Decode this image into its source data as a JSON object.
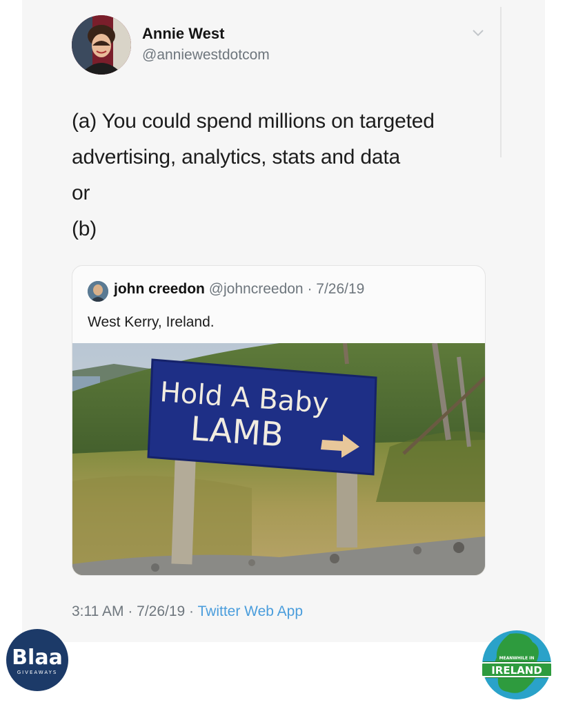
{
  "tweet": {
    "author_name": "Annie West",
    "author_handle": "@anniewestdotcom",
    "lines": [
      "(a) You could spend millions on targeted",
      "advertising, analytics, stats and data",
      "or",
      "(b)"
    ],
    "timestamp": "3:11 AM · 7/26/19 · ",
    "source": "Twitter Web App"
  },
  "quoted_tweet": {
    "author_name": "john creedon",
    "author_meta": "@johncreedon · 7/26/19",
    "text": "West Kerry, Ireland.",
    "photo": {
      "sign_line1": "Hold A Baby",
      "sign_line2": "LAMB"
    }
  },
  "watermarks": {
    "left_logo": {
      "brand": "Blaa",
      "tagline": "GIVEAWAYS",
      "color": "#1c3a68"
    },
    "right_logo": {
      "top_text": "MEANWHILE IN",
      "brand": "IRELAND",
      "color": "#2e9b3e"
    }
  },
  "colors": {
    "handle_gray": "#6e767d",
    "link_blue": "#4a9ddc",
    "sign_blue": "#1e2f86"
  }
}
